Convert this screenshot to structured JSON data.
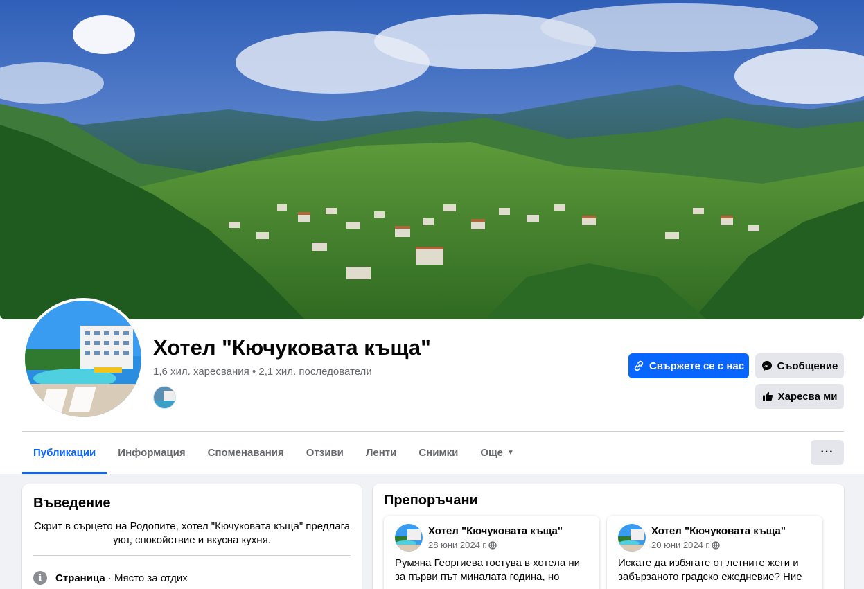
{
  "page": {
    "title": "Хотел \"Кючуковата къща\"",
    "likes": "1,6 хил. харесвания",
    "separator": "•",
    "followers": "2,1 хил. последователи"
  },
  "actions": {
    "contact": "Свържете се с нас",
    "message": "Съобщение",
    "like": "Харесва ми",
    "more": "···"
  },
  "tabs": [
    {
      "label": "Публикации",
      "active": true
    },
    {
      "label": "Информация"
    },
    {
      "label": "Споменавания"
    },
    {
      "label": "Отзиви"
    },
    {
      "label": "Ленти"
    },
    {
      "label": "Снимки"
    },
    {
      "label": "Още"
    }
  ],
  "intro": {
    "title": "Въведение",
    "bio": "Скрит в сърцето на Родопите, хотел \"Кючуковата къща\" предлага уют, спокойствие и вкусна кухня.",
    "category_label": "Страница",
    "category_value": " · Място за отдих"
  },
  "featured": {
    "title": "Препоръчани",
    "posts": [
      {
        "author": "Хотел \"Кючуковата къща\"",
        "date": "28 юни 2024 г.",
        "text": "Румяна Георгиева гостува в хотела ни за първи път миналата година, но"
      },
      {
        "author": "Хотел \"Кючуковата къща\"",
        "date": "20 юни 2024 г.",
        "text": "Искате да избягате от летните жеги и забързаното градско ежедневие? Ние"
      }
    ]
  },
  "colors": {
    "accent": "#0866ff",
    "secondary_button": "#e4e6eb",
    "muted_text": "#65676b"
  }
}
